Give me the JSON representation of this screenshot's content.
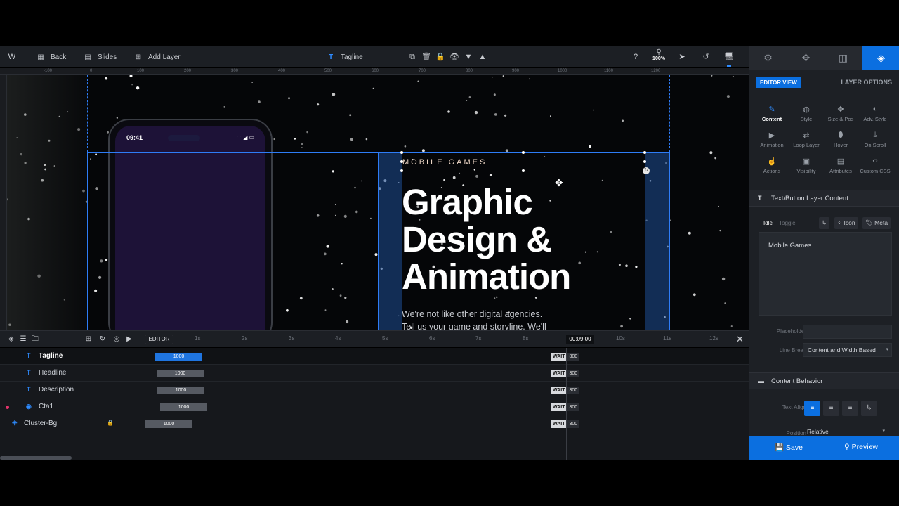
{
  "toolbar": {
    "wp_logo": "W",
    "back_label": "Back",
    "slides_label": "Slides",
    "add_layer_label": "Add Layer",
    "current_layer_type": "T",
    "current_layer": "Tagline",
    "zoom": "100%"
  },
  "ruler": {
    "ticks": [
      "-100",
      "0",
      "100",
      "200",
      "300",
      "400",
      "500",
      "600",
      "700",
      "800",
      "900",
      "1000",
      "1100",
      "1200"
    ]
  },
  "canvas": {
    "phone_time": "09:41",
    "tagline": "MOBILE GAMES",
    "headline_lines": [
      "Graphic",
      "Design &",
      "Animation"
    ],
    "description_lines": [
      "We're not like other digital agencies.",
      "Tell us your game and storyline. We'll"
    ]
  },
  "timeline": {
    "editor_label": "EDITOR",
    "ticks": [
      "1s",
      "2s",
      "3s",
      "4s",
      "5s",
      "6s",
      "7s",
      "8s",
      "10s",
      "11s",
      "12s"
    ],
    "current_time": "00:09:00",
    "rows": [
      {
        "name": "Tagline",
        "type_icon": "T",
        "duration": "1000",
        "wait_label": "WAIT",
        "wait_value": "300"
      },
      {
        "name": "Headline",
        "type_icon": "T",
        "duration": "1000",
        "wait_label": "WAIT",
        "wait_value": "300"
      },
      {
        "name": "Description",
        "type_icon": "T",
        "duration": "1000",
        "wait_label": "WAIT",
        "wait_value": "300"
      },
      {
        "name": "Cta1",
        "type_icon": "◉",
        "duration": "1000",
        "wait_label": "WAIT",
        "wait_value": "300"
      },
      {
        "name": "Cluster-Bg",
        "type_icon": "⁜",
        "duration": "1000",
        "wait_label": "WAIT",
        "wait_value": "300"
      }
    ]
  },
  "panel": {
    "editor_view": "EDITOR VIEW",
    "layer_options": "LAYER OPTIONS",
    "options": [
      {
        "label": "Content",
        "icon": "pencil-icon"
      },
      {
        "label": "Style",
        "icon": "palette-icon"
      },
      {
        "label": "Size & Pos",
        "icon": "move-icon"
      },
      {
        "label": "Adv. Style",
        "icon": "contrast-icon"
      },
      {
        "label": "Animation",
        "icon": "play-icon"
      },
      {
        "label": "Loop Layer",
        "icon": "loop-icon"
      },
      {
        "label": "Hover",
        "icon": "mouse-icon"
      },
      {
        "label": "On Scroll",
        "icon": "scroll-icon"
      },
      {
        "label": "Actions",
        "icon": "hand-icon"
      },
      {
        "label": "Visibility",
        "icon": "visibility-icon"
      },
      {
        "label": "Attributes",
        "icon": "document-icon"
      },
      {
        "label": "Custom CSS",
        "icon": "code-icon"
      }
    ],
    "content_section_title": "Text/Button Layer Content",
    "content_tabs": [
      "Idle",
      "Toggle"
    ],
    "icon_label": "Icon",
    "meta_label": "Meta",
    "content_value": "Mobile Games",
    "placeholder_label": "Placeholder",
    "placeholder_value": "",
    "line_break_label": "Line Break",
    "line_break_value": "Content and Width Based",
    "behavior_section_title": "Content Behavior",
    "text_align_label": "Text Align",
    "position_label": "Position",
    "position_value": "Relative",
    "save_label": "Save",
    "preview_label": "Preview"
  }
}
